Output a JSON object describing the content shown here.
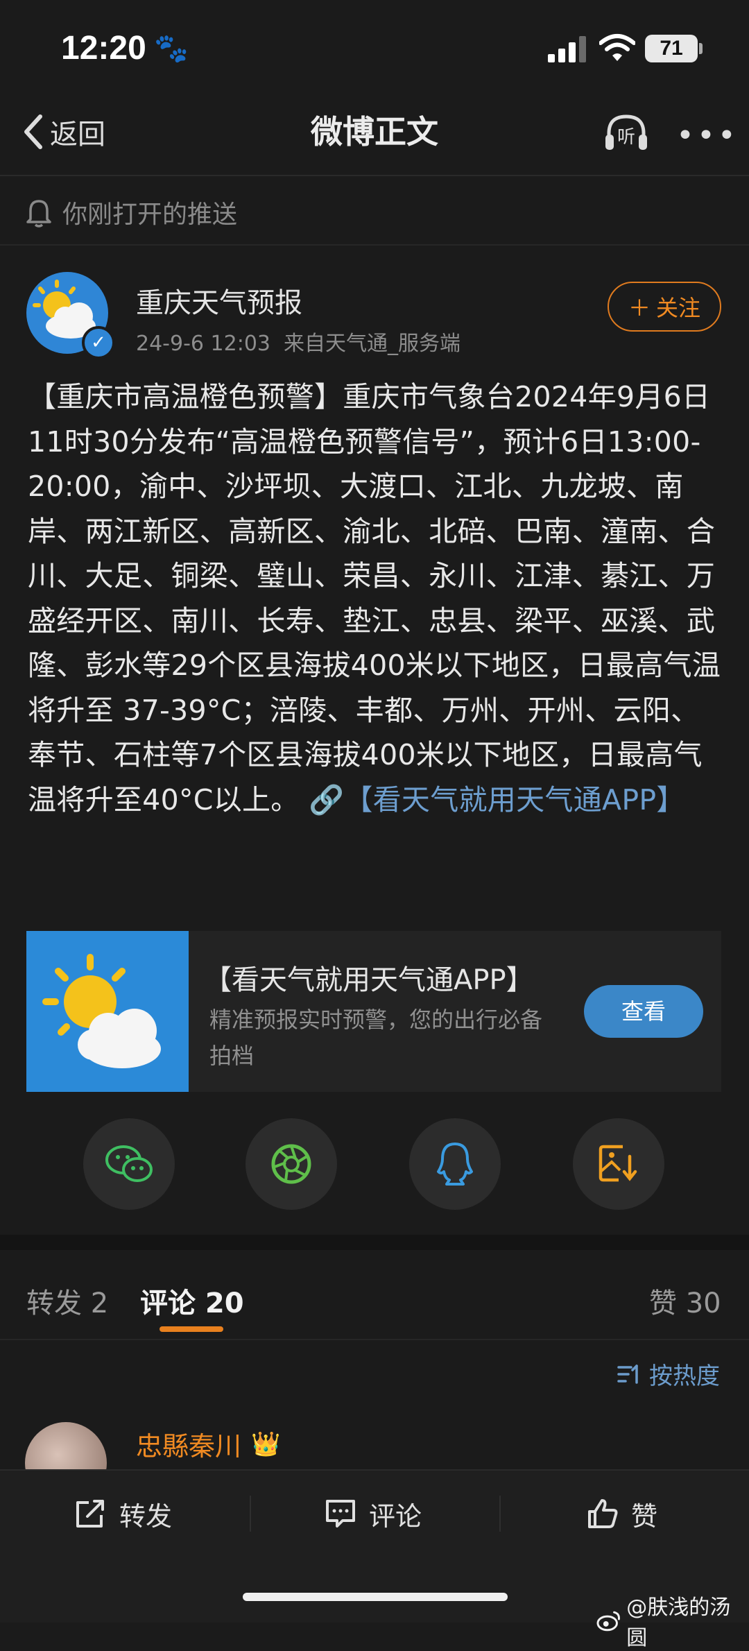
{
  "status_bar": {
    "time": "12:20",
    "battery": "71"
  },
  "nav": {
    "back_label": "返回",
    "title": "微博正文",
    "listen_label": "听"
  },
  "push_notice": "你刚打开的推送",
  "post": {
    "author": "重庆天气预报",
    "meta": "24-9-6 12:03  来自天气通_服务端",
    "follow_label": "关注",
    "text": "【重庆市高温橙色预警】重庆市气象台2024年9月6日11时30分发布“高温橙色预警信号”，预计6日13:00-20:00，渝中、沙坪坝、大渡口、江北、九龙坡、南岸、两江新区、高新区、渝北、北碚、巴南、潼南、合川、大足、铜梁、璧山、荣昌、永川、江津、綦江、万盛经开区、南川、长寿、垫江、忠县、梁平、巫溪、武隆、彭水等29个区县海拔400米以下地区，日最高气温将升至 37-39°C；涪陵、丰都、万州、开州、云阳、奉节、石柱等7个区县海拔400米以下地区，日最高气温将升至40°C以上。",
    "link_text": "【看天气就用天气通APP】"
  },
  "card": {
    "title": "【看天气就用天气通APP】",
    "desc": "精准预报实时预警，您的出行必备拍档",
    "button": "查看"
  },
  "share_icons": [
    "wechat-icon",
    "moments-icon",
    "qq-icon",
    "save-image-icon"
  ],
  "tabs": {
    "repost": "转发 2",
    "comment": "评论 20",
    "like": "赞 30"
  },
  "sort_label": "按热度",
  "comment": {
    "name": "忠縣秦川"
  },
  "bottom_bar": {
    "repost": "转发",
    "comment": "评论",
    "like": "赞"
  },
  "watermark": "@肤浅的汤圆",
  "colors": {
    "accent": "#f08a22",
    "link": "#6d9ecf",
    "background": "#1b1b1b"
  }
}
